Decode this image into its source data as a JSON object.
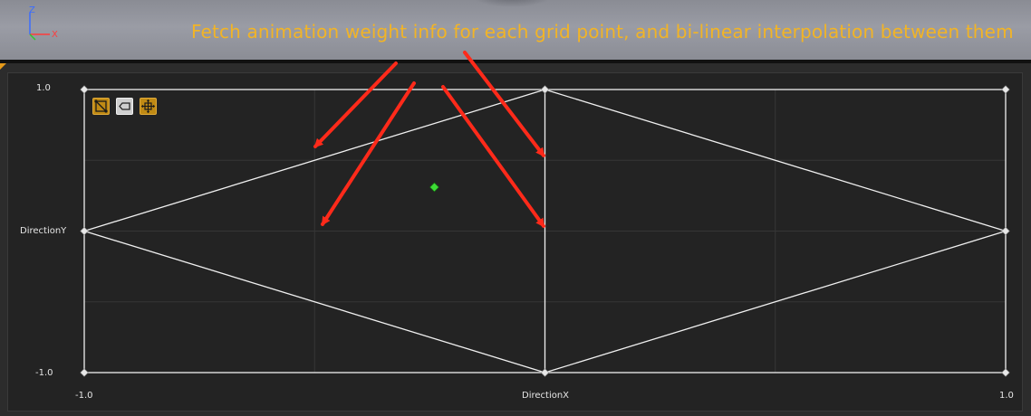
{
  "viewport": {
    "axis_gizmo": {
      "z": "Z",
      "x": "X"
    },
    "annotation_text": "Fetch animation weight info for each grid point, and bi-linear interpolation between them",
    "annotation_color": "#f2b426"
  },
  "blend_space": {
    "y_axis_name": "DirectionY",
    "x_axis_name": "DirectionX",
    "y_max_label": "1.0",
    "y_min_label": "-1.0",
    "x_min_label": "-1.0",
    "x_max_label": "1.0",
    "x_range": [
      -1.0,
      1.0
    ],
    "y_range": [
      -1.0,
      1.0
    ],
    "grid_divisions": {
      "x": 4,
      "y": 4
    },
    "sample_points": [
      {
        "x": -1.0,
        "y": 1.0
      },
      {
        "x": 0.0,
        "y": 1.0
      },
      {
        "x": 1.0,
        "y": 1.0
      },
      {
        "x": -1.0,
        "y": 0.0
      },
      {
        "x": 1.0,
        "y": 0.0
      },
      {
        "x": -1.0,
        "y": -1.0
      },
      {
        "x": 0.0,
        "y": -1.0
      },
      {
        "x": 1.0,
        "y": -1.0
      }
    ],
    "triangulation_edges": [
      [
        [
          -1,
          0
        ],
        [
          0,
          1
        ]
      ],
      [
        [
          -1,
          0
        ],
        [
          0,
          -1
        ]
      ],
      [
        [
          0,
          1
        ],
        [
          1,
          0
        ]
      ],
      [
        [
          0,
          -1
        ],
        [
          1,
          0
        ]
      ],
      [
        [
          0,
          1
        ],
        [
          0,
          -1
        ]
      ]
    ],
    "preview_point": {
      "x": -0.24,
      "y": 0.31
    },
    "preview_color": "#3ddc35",
    "line_color": "#f0f0f0",
    "arrow_color": "#ff2a1a",
    "toolbar": [
      {
        "name": "triangulation-toggle",
        "icon": "triangle-grid-icon",
        "active": true
      },
      {
        "name": "sample-label-toggle",
        "icon": "tag-icon",
        "active": false
      },
      {
        "name": "fit-view-toggle",
        "icon": "move-arrows-icon",
        "active": true
      }
    ]
  }
}
